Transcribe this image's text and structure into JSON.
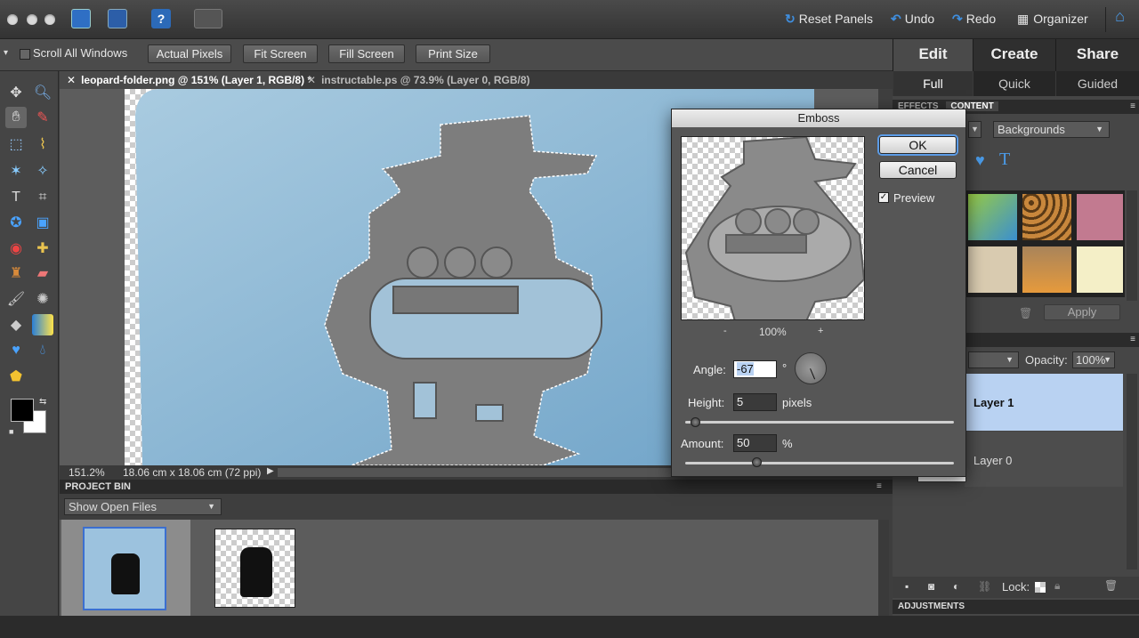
{
  "top_bar": {
    "reset_panels": "Reset Panels",
    "undo": "Undo",
    "redo": "Redo",
    "organizer": "Organizer",
    "help": "?"
  },
  "options_bar": {
    "scroll_all_windows": "Scroll All Windows",
    "buttons": [
      "Actual Pixels",
      "Fit Screen",
      "Fill Screen",
      "Print Size"
    ]
  },
  "mode_tabs": [
    "Edit",
    "Create",
    "Share"
  ],
  "sub_tabs": [
    "Full",
    "Quick",
    "Guided"
  ],
  "doc_tabs": [
    {
      "label": "leopard-folder.png @ 151% (Layer 1, RGB/8) *",
      "active": true
    },
    {
      "label": "instructable.ps @ 73.9% (Layer 0, RGB/8)",
      "active": false
    }
  ],
  "status": {
    "zoom": "151.2%",
    "size": "18.06 cm x 18.06 cm (72 ppi)"
  },
  "project_bin": {
    "title": "PROJECT BIN",
    "dropdown": "Show Open Files"
  },
  "effects_panel": {
    "tab_effects": "EFFECTS",
    "tab_content": "CONTENT",
    "category": "Backgrounds",
    "apply": "Apply"
  },
  "layers_panel": {
    "opacity_label": "Opacity:",
    "opacity_value": "100%",
    "layers": [
      "Layer 1",
      "Layer 0"
    ],
    "lock_label": "Lock:"
  },
  "adjustments": {
    "title": "ADJUSTMENTS"
  },
  "emboss_dialog": {
    "title": "Emboss",
    "ok": "OK",
    "cancel": "Cancel",
    "preview_label": "Preview",
    "preview_checked": true,
    "zoom": "100%",
    "zoom_out": "-",
    "zoom_in": "+",
    "angle_label": "Angle:",
    "angle_value": "-67",
    "angle_unit": "°",
    "height_label": "Height:",
    "height_value": "5",
    "height_unit": "pixels",
    "amount_label": "Amount:",
    "amount_value": "50",
    "amount_unit": "%"
  },
  "colors": {
    "accent": "#3f8fe0",
    "selected_layer": "#b9d2f2"
  }
}
